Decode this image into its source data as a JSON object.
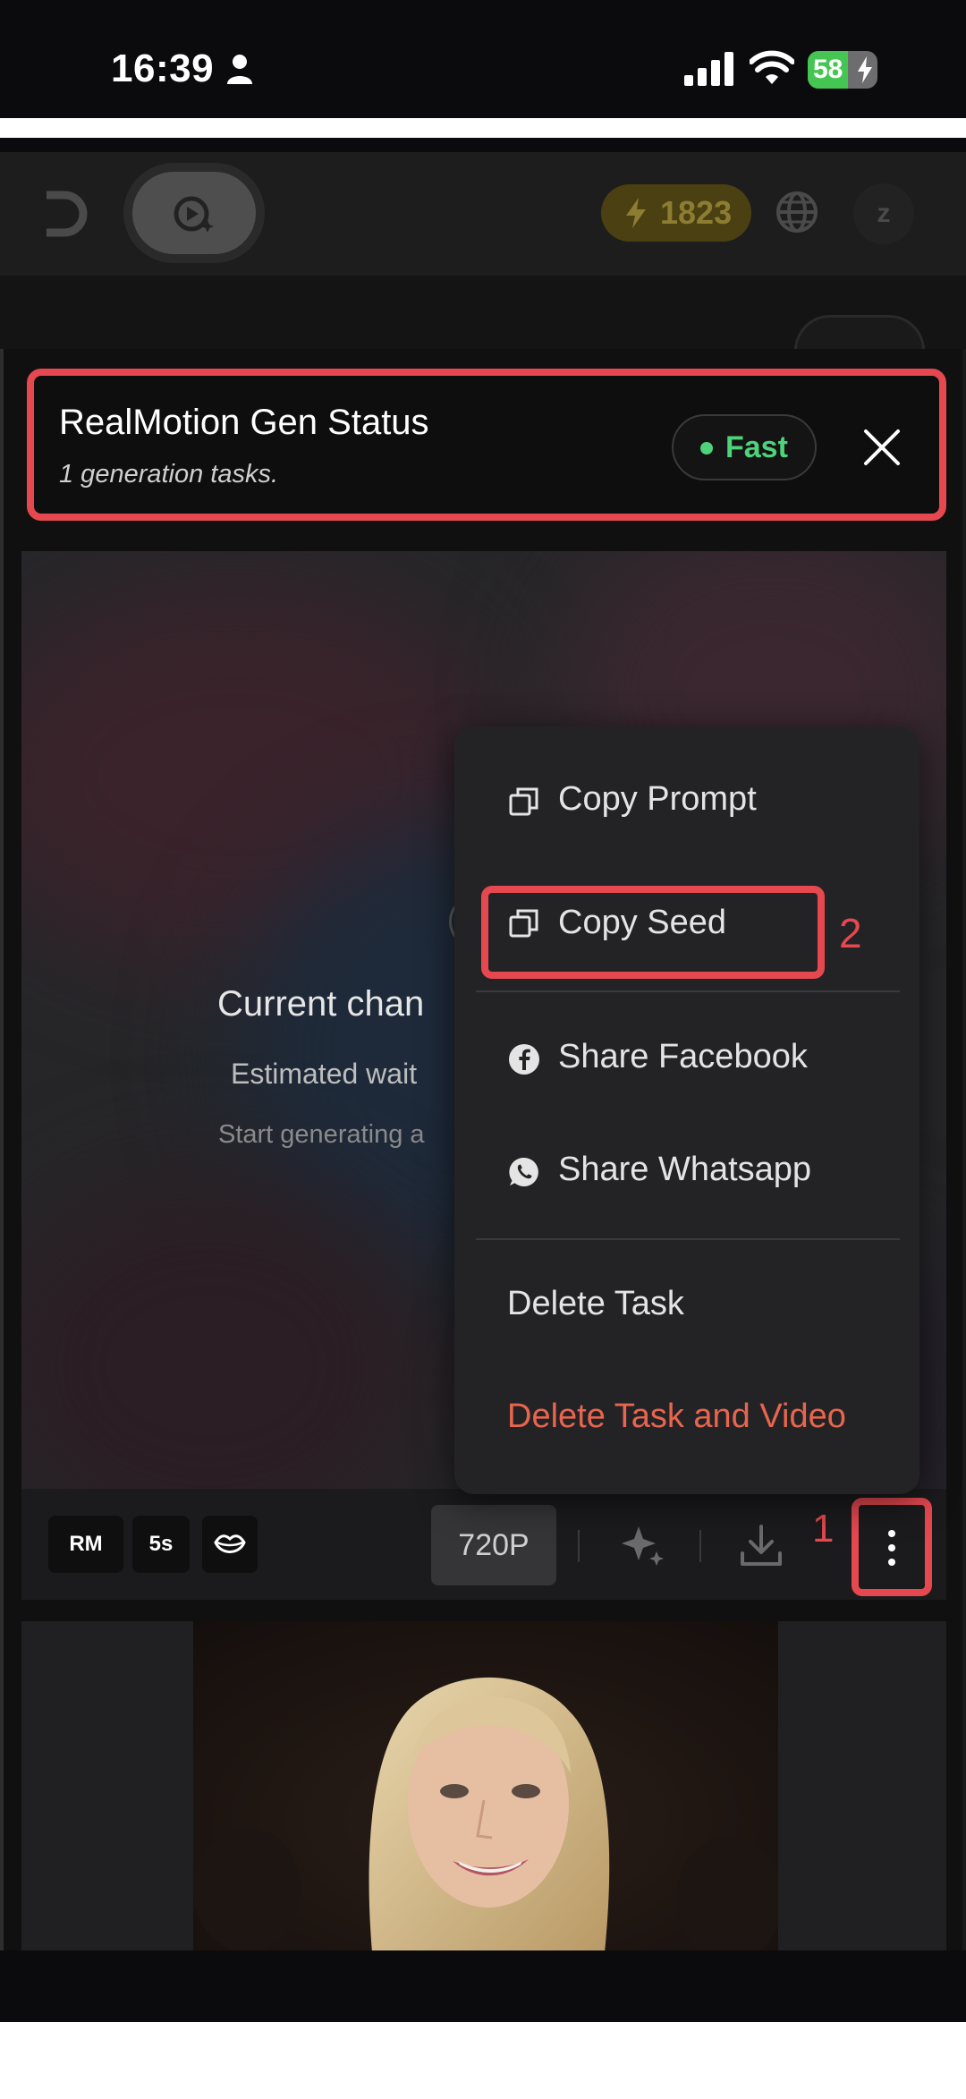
{
  "status_bar": {
    "time": "16:39",
    "battery_level": "58",
    "battery_fraction": 0.58,
    "icons": [
      "person-icon",
      "signal-icon",
      "wifi-icon",
      "battery-icon"
    ]
  },
  "header": {
    "credits": "1823",
    "avatar_initial": "z",
    "icons": [
      "back-icon",
      "video-generate-icon",
      "lightning-icon",
      "globe-icon"
    ]
  },
  "banner": {
    "title": "RealMotion Gen Status",
    "subtitle": "1 generation tasks.",
    "badge": "Fast",
    "colors": {
      "badge": "#4ed27a",
      "highlight": "#e5484f"
    }
  },
  "task_card": {
    "queue_title": "Current chan",
    "queue_wait": "Estimated wait",
    "queue_start": "Start generating a"
  },
  "toolbar": {
    "chips": [
      "RM",
      "5s"
    ],
    "resolution": "720P",
    "annotation": "1",
    "icons": [
      "lips-icon",
      "sparkle-icon",
      "download-icon",
      "more-vertical-icon"
    ]
  },
  "menu": {
    "copy_prompt": "Copy Prompt",
    "copy_seed": "Copy Seed",
    "share_facebook": "Share Facebook",
    "share_whatsapp": "Share Whatsapp",
    "delete_task": "Delete Task",
    "delete_task_video": "Delete Task and Video",
    "annotation": "2",
    "colors": {
      "danger": "#e8654e"
    },
    "icons": [
      "copy-icon",
      "facebook-icon",
      "whatsapp-icon"
    ]
  }
}
